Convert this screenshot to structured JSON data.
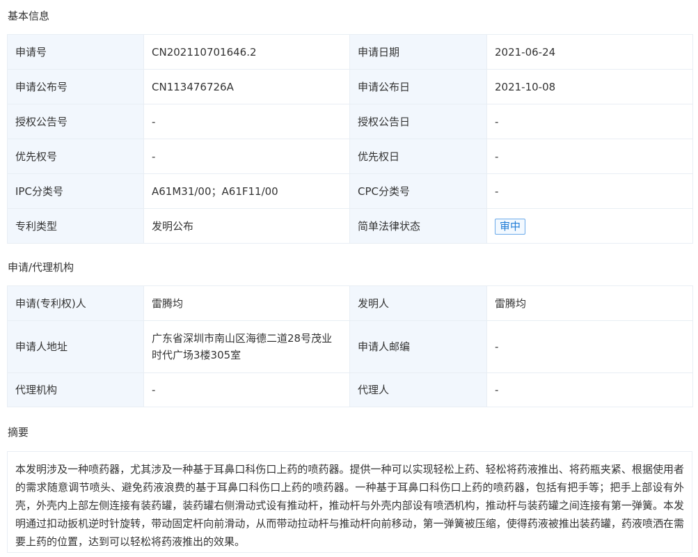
{
  "basic": {
    "title": "基本信息",
    "rows": [
      {
        "l1": "申请号",
        "v1": "CN202110701646.2",
        "l2": "申请日期",
        "v2": "2021-06-24"
      },
      {
        "l1": "申请公布号",
        "v1": "CN113476726A",
        "l2": "申请公布日",
        "v2": "2021-10-08"
      },
      {
        "l1": "授权公告号",
        "v1": "-",
        "l2": "授权公告日",
        "v2": "-"
      },
      {
        "l1": "优先权号",
        "v1": "-",
        "l2": "优先权日",
        "v2": "-"
      },
      {
        "l1": "IPC分类号",
        "v1": "A61M31/00；A61F11/00",
        "l2": "CPC分类号",
        "v2": "-"
      },
      {
        "l1": "专利类型",
        "v1": "发明公布",
        "l2": "简单法律状态",
        "v2": "审中"
      }
    ]
  },
  "agency": {
    "title": "申请/代理机构",
    "rows": [
      {
        "l1": "申请(专利权)人",
        "v1": "雷腾均",
        "l2": "发明人",
        "v2": "雷腾均"
      },
      {
        "l1": "申请人地址",
        "v1": "广东省深圳市南山区海德二道28号茂业时代广场3楼305室",
        "l2": "申请人邮编",
        "v2": "-"
      },
      {
        "l1": "代理机构",
        "v1": "-",
        "l2": "代理人",
        "v2": "-"
      }
    ]
  },
  "abstract": {
    "title": "摘要",
    "text": "本发明涉及一种喷药器，尤其涉及一种基于耳鼻口科伤口上药的喷药器。提供一种可以实现轻松上药、轻松将药液推出、将药瓶夹紧、根据使用者的需求随意调节喷头、避免药液浪费的基于耳鼻口科伤口上药的喷药器。一种基于耳鼻口科伤口上药的喷药器，包括有把手等；把手上部设有外壳，外壳内上部左侧连接有装药罐，装药罐右侧滑动式设有推动杆，推动杆与外壳内部设有喷洒机构，推动杆与装药罐之间连接有第一弹簧。本发明通过扣动扳机逆时针旋转，带动固定杆向前滑动，从而带动拉动杆与推动杆向前移动，第一弹簧被压缩，使得药液被推出装药罐，药液喷洒在需要上药的位置，达到可以轻松将药液推出的效果。"
  },
  "colors": {
    "label_bg": "#f2f7fd",
    "border": "#e8eef4",
    "status_blue": "#1f7cd6"
  }
}
